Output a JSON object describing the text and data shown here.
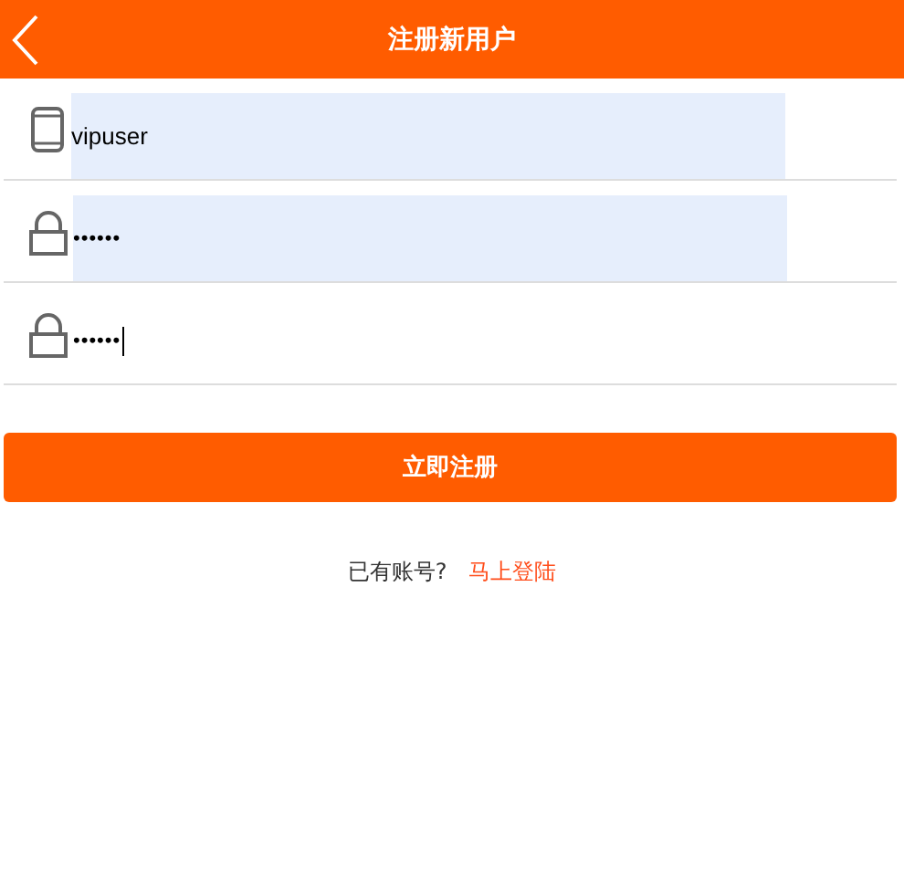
{
  "header": {
    "title": "注册新用户"
  },
  "fields": [
    {
      "kind": "phone",
      "value": "vipuser",
      "autofilled": true,
      "focused": false
    },
    {
      "kind": "lock",
      "value": "••••••",
      "autofilled": true,
      "focused": false
    },
    {
      "kind": "lock",
      "value": "••••••",
      "autofilled": false,
      "focused": true
    }
  ],
  "submit": "立即注册",
  "footer": {
    "prompt": "已有账号?",
    "link": "马上登陆"
  }
}
